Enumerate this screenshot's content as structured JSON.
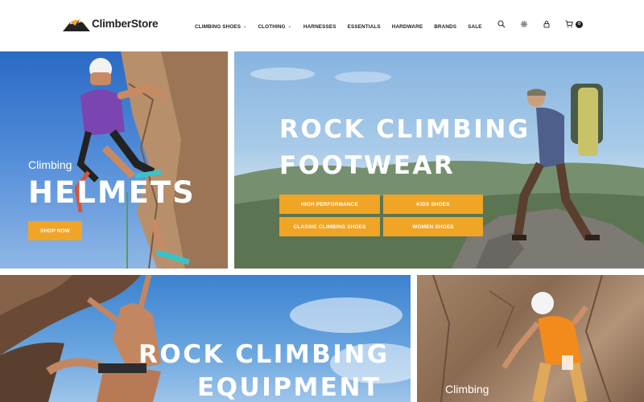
{
  "header": {
    "logo_text": "ClimberStore",
    "nav": [
      {
        "label": "CLIMBING SHOES",
        "dropdown": true
      },
      {
        "label": "CLOTHING",
        "dropdown": true
      },
      {
        "label": "HARNESSES",
        "dropdown": false
      },
      {
        "label": "ESSENTIALS",
        "dropdown": false
      },
      {
        "label": "HARDWARE",
        "dropdown": false
      },
      {
        "label": "BRANDS",
        "dropdown": false
      },
      {
        "label": "SALE",
        "dropdown": false
      }
    ],
    "icons": [
      "search-icon",
      "gear-icon",
      "lock-icon",
      "cart-icon"
    ],
    "cart_count": "0"
  },
  "banners": {
    "helmets": {
      "small": "Climbing",
      "big": "HELMETS",
      "button": "SHOP NOW"
    },
    "footwear": {
      "line1": "ROCK CLIMBING",
      "line2": "FOOTWEAR",
      "buttons": [
        "HIGH PERFORMANCE",
        "KIDS SHOES",
        "CLASSIC CLIMBING SHOES",
        "WOMEN SHOES"
      ]
    },
    "equipment": {
      "line1": "ROCK CLIMBING",
      "line2": "EQUIPMENT"
    },
    "climbing": {
      "small": "Climbing"
    }
  },
  "colors": {
    "accent": "#f0a526",
    "text_dark": "#222222"
  }
}
